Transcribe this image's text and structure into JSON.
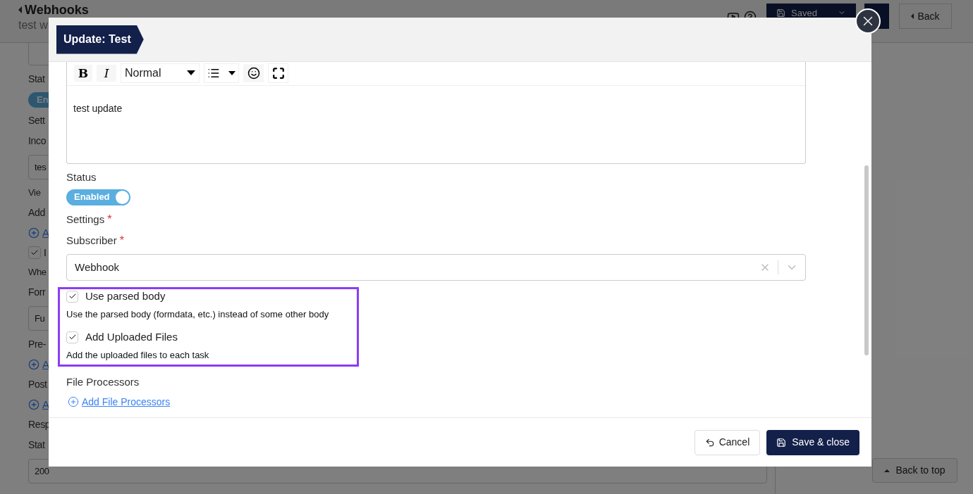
{
  "page": {
    "title": "Webhooks",
    "subtitle": "test w",
    "header_buttons": [
      {
        "kind": "saved",
        "label": "Saved"
      },
      {
        "kind": "dark"
      },
      {
        "kind": "back",
        "label": "Back"
      }
    ],
    "fields": [
      {
        "kind": "input"
      },
      {
        "kind": "label",
        "text": "Stat"
      },
      {
        "kind": "toggle",
        "text": "En",
        "on": true
      },
      {
        "kind": "label",
        "text": "Sett"
      },
      {
        "kind": "label",
        "text": "Inco"
      },
      {
        "kind": "input",
        "value": "tes"
      },
      {
        "kind": "hint",
        "text": "Vie"
      },
      {
        "kind": "label",
        "text": "Add"
      },
      {
        "kind": "link",
        "text": "A"
      },
      {
        "kind": "checkbox",
        "text": "I",
        "checked": true
      },
      {
        "kind": "hint",
        "text": "Whe"
      },
      {
        "kind": "label",
        "text": "Forr"
      },
      {
        "kind": "input",
        "value": "Fu"
      },
      {
        "kind": "label",
        "text": "Pre-"
      },
      {
        "kind": "link",
        "text": "A"
      },
      {
        "kind": "label",
        "text": "Post"
      },
      {
        "kind": "link",
        "text": "A"
      },
      {
        "kind": "label",
        "text": "Resp"
      },
      {
        "kind": "label",
        "text": "Stat"
      },
      {
        "kind": "input",
        "value": "200",
        "wide": true
      }
    ],
    "back_to_top": "Back to top"
  },
  "modal": {
    "title": "Update: Test",
    "editor": {
      "bold": "B",
      "italic": "I",
      "format": "Normal",
      "text": "test update"
    },
    "status": {
      "label": "Status",
      "toggle": {
        "text": "Enabled",
        "on": true
      }
    },
    "settings": {
      "label": "Settings",
      "required_mark": "*"
    },
    "subscriber": {
      "label": "Subscriber",
      "required_mark": "*",
      "value": "Webhook"
    },
    "options": {
      "highlighted": true,
      "items": [
        {
          "label": "Use parsed body",
          "checked": true,
          "description": "Use the parsed body (formdata, etc.) instead of some other body"
        },
        {
          "label": "Add Uploaded Files",
          "checked": true,
          "description": "Add the uploaded files to each task"
        }
      ]
    },
    "file_processors": {
      "label": "File Processors",
      "link": "Add File Processors"
    },
    "buttons": [
      {
        "kind": "cancel",
        "label": "Cancel"
      },
      {
        "kind": "save",
        "label": "Save & close"
      }
    ]
  }
}
